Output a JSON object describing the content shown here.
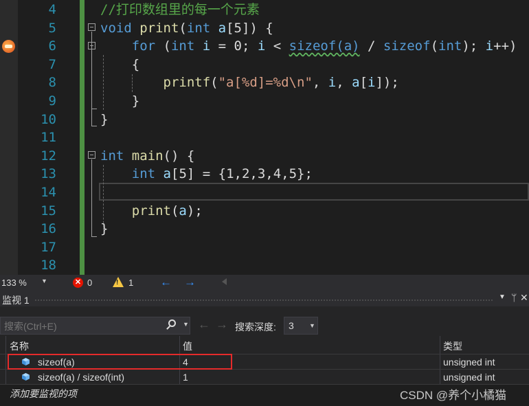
{
  "editor": {
    "lines": [
      {
        "num": "4",
        "tokens": [
          {
            "t": "//打印数组里的每一个元素",
            "c": "cm"
          }
        ]
      },
      {
        "num": "5",
        "tokens": [
          {
            "t": "void",
            "c": "kw"
          },
          {
            "t": " "
          },
          {
            "t": "print",
            "c": "fn"
          },
          {
            "t": "("
          },
          {
            "t": "int",
            "c": "kw"
          },
          {
            "t": " "
          },
          {
            "t": "a",
            "c": "var"
          },
          {
            "t": "[5]) {"
          }
        ]
      },
      {
        "num": "6",
        "tokens": [
          {
            "t": "    "
          },
          {
            "t": "for",
            "c": "kw"
          },
          {
            "t": " ("
          },
          {
            "t": "int",
            "c": "kw"
          },
          {
            "t": " "
          },
          {
            "t": "i",
            "c": "var"
          },
          {
            "t": " = 0; "
          },
          {
            "t": "i",
            "c": "var"
          },
          {
            "t": " < "
          },
          {
            "t": "sizeof(a)",
            "c": "kw squig"
          },
          {
            "t": " / "
          },
          {
            "t": "sizeof",
            "c": "kw"
          },
          {
            "t": "("
          },
          {
            "t": "int",
            "c": "kw"
          },
          {
            "t": "); "
          },
          {
            "t": "i",
            "c": "var"
          },
          {
            "t": "++)"
          }
        ]
      },
      {
        "num": "7",
        "tokens": [
          {
            "t": "    {"
          }
        ]
      },
      {
        "num": "8",
        "tokens": [
          {
            "t": "        "
          },
          {
            "t": "printf",
            "c": "fn"
          },
          {
            "t": "("
          },
          {
            "t": "\"a[%d]=%d\\n\"",
            "c": "str"
          },
          {
            "t": ", "
          },
          {
            "t": "i",
            "c": "var"
          },
          {
            "t": ", "
          },
          {
            "t": "a",
            "c": "var"
          },
          {
            "t": "["
          },
          {
            "t": "i",
            "c": "var"
          },
          {
            "t": "]);"
          }
        ]
      },
      {
        "num": "9",
        "tokens": [
          {
            "t": "    }"
          }
        ]
      },
      {
        "num": "10",
        "tokens": [
          {
            "t": "}"
          }
        ]
      },
      {
        "num": "11",
        "tokens": []
      },
      {
        "num": "12",
        "tokens": [
          {
            "t": "int",
            "c": "kw"
          },
          {
            "t": " "
          },
          {
            "t": "main",
            "c": "fn"
          },
          {
            "t": "() {"
          }
        ]
      },
      {
        "num": "13",
        "tokens": [
          {
            "t": "    "
          },
          {
            "t": "int",
            "c": "kw"
          },
          {
            "t": " "
          },
          {
            "t": "a",
            "c": "var"
          },
          {
            "t": "[5] = {1,2,3,4,5};"
          }
        ]
      },
      {
        "num": "14",
        "tokens": []
      },
      {
        "num": "15",
        "tokens": [
          {
            "t": "    "
          },
          {
            "t": "print",
            "c": "fn"
          },
          {
            "t": "("
          },
          {
            "t": "a",
            "c": "var"
          },
          {
            "t": ");"
          }
        ]
      },
      {
        "num": "16",
        "tokens": [
          {
            "t": "}"
          }
        ]
      },
      {
        "num": "17",
        "tokens": []
      },
      {
        "num": "18",
        "tokens": []
      }
    ]
  },
  "status": {
    "zoom": "133 %",
    "errors": "0",
    "warnings": "1"
  },
  "watch": {
    "title": "监视 1",
    "search_placeholder": "搜索(Ctrl+E)",
    "depth_label": "搜索深度:",
    "depth_value": "3",
    "headers": {
      "name": "名称",
      "value": "值",
      "type": "类型"
    },
    "rows": [
      {
        "name": "sizeof(a)",
        "value": "4",
        "type": "unsigned int"
      },
      {
        "name": "sizeof(a) / sizeof(int)",
        "value": "1",
        "type": "unsigned int"
      }
    ],
    "add_item": "添加要监视的项"
  },
  "watermark": "CSDN @养个小橘猫",
  "colors": {
    "highlight": "#e52b2b",
    "keyword": "#569cd6",
    "comment": "#57a64a",
    "string": "#d69d85",
    "function": "#dcdcaa"
  }
}
